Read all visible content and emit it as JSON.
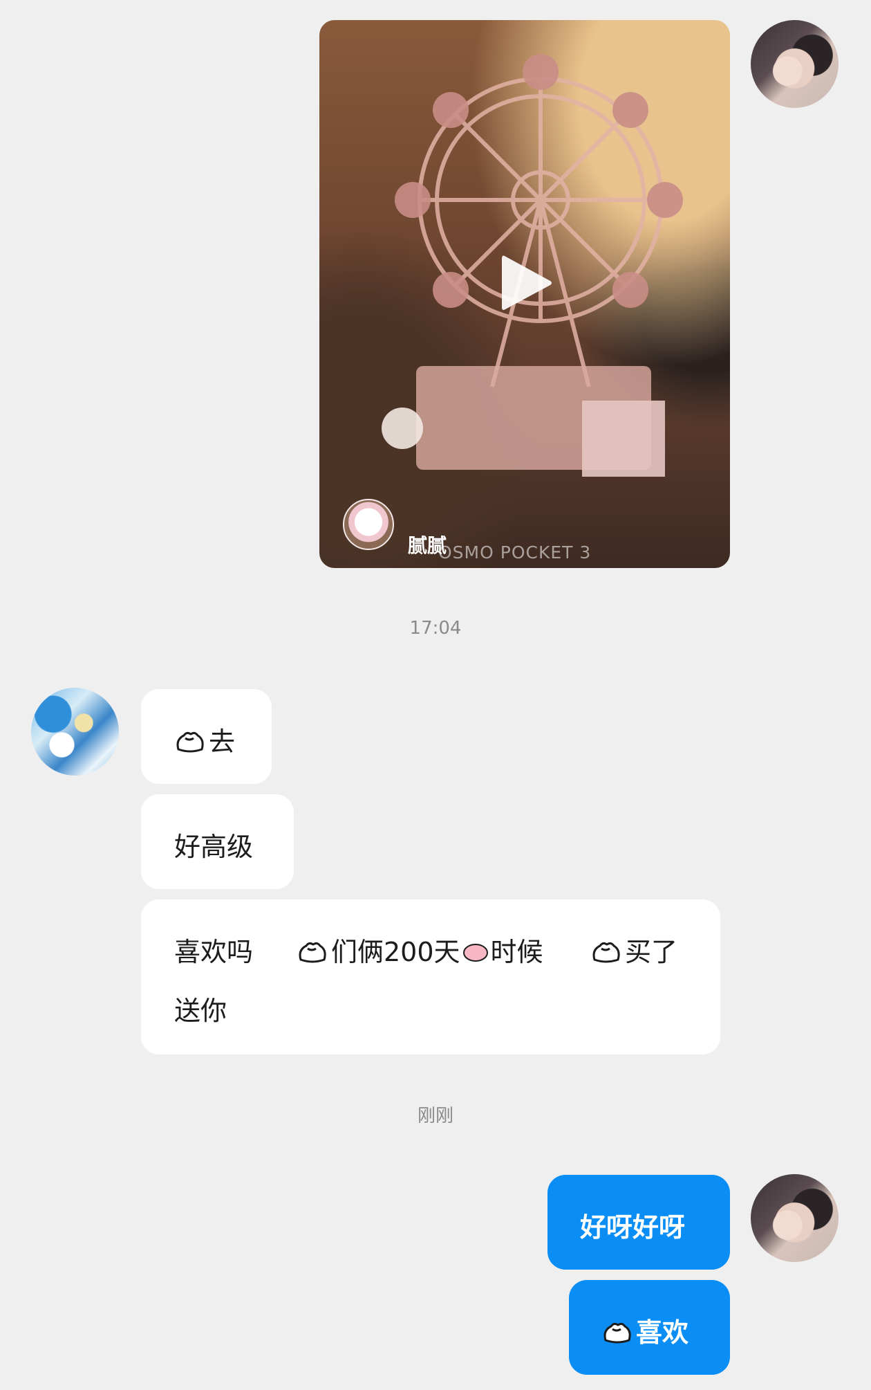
{
  "video_message": {
    "author_name": "腻腻",
    "watermark": "OSMO POCKET 3",
    "sender": "me"
  },
  "timestamps": {
    "first": "17:04",
    "second": "刚刚"
  },
  "incoming_messages": {
    "msg1": "去",
    "msg2": "好高级",
    "msg3_line1_a": "喜欢吗",
    "msg3_line1_b": "们俩200天",
    "msg3_line1_c": "时候",
    "msg3_line1_d": "买了",
    "msg3_line2": "送你"
  },
  "outgoing_messages": {
    "msg1": "好呀好呀",
    "msg2": "喜欢"
  },
  "colors": {
    "background": "#efefef",
    "outgoing_bubble": "#0a8ef5",
    "incoming_bubble": "#ffffff",
    "timestamp_text": "#8a8a8a"
  },
  "icons": {
    "emoji": "blob-face-emoji",
    "heart": "pink-heart-emoji",
    "play": "play-icon"
  }
}
